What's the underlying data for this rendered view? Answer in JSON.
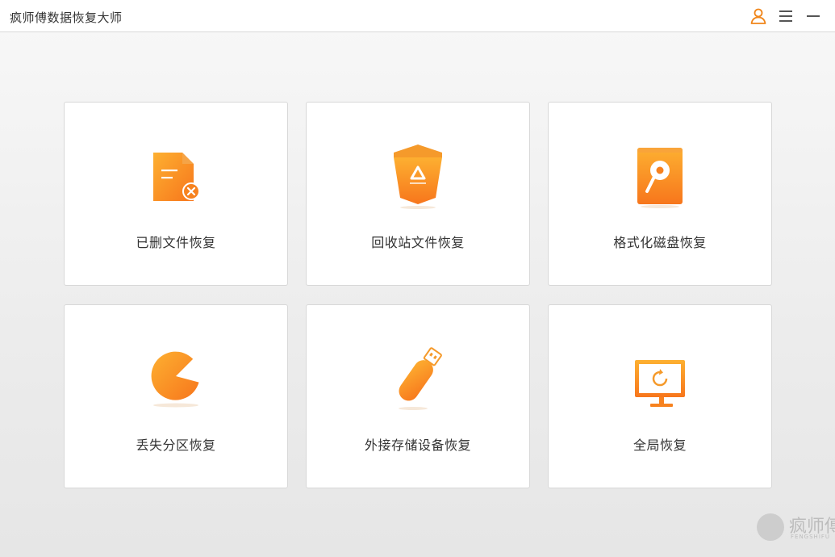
{
  "app": {
    "title": "疯师傅数据恢复大师"
  },
  "titlebar": {
    "icons": [
      "user-icon",
      "menu-icon",
      "minimize-icon"
    ],
    "accent_color": "#f08519"
  },
  "cards": [
    {
      "label": "已删文件恢复",
      "icon": "deleted-file-icon"
    },
    {
      "label": "回收站文件恢复",
      "icon": "recycle-bin-icon"
    },
    {
      "label": "格式化磁盘恢复",
      "icon": "formatted-disk-icon"
    },
    {
      "label": "丢失分区恢复",
      "icon": "lost-partition-icon"
    },
    {
      "label": "外接存储设备恢复",
      "icon": "usb-drive-icon"
    },
    {
      "label": "全局恢复",
      "icon": "full-scan-icon"
    }
  ],
  "watermark": {
    "text": "疯师傅",
    "subtext": "FENGSHIFU"
  },
  "colors": {
    "orange_light": "#fdb031",
    "orange_dark": "#f7761c",
    "background": "#efefef"
  }
}
